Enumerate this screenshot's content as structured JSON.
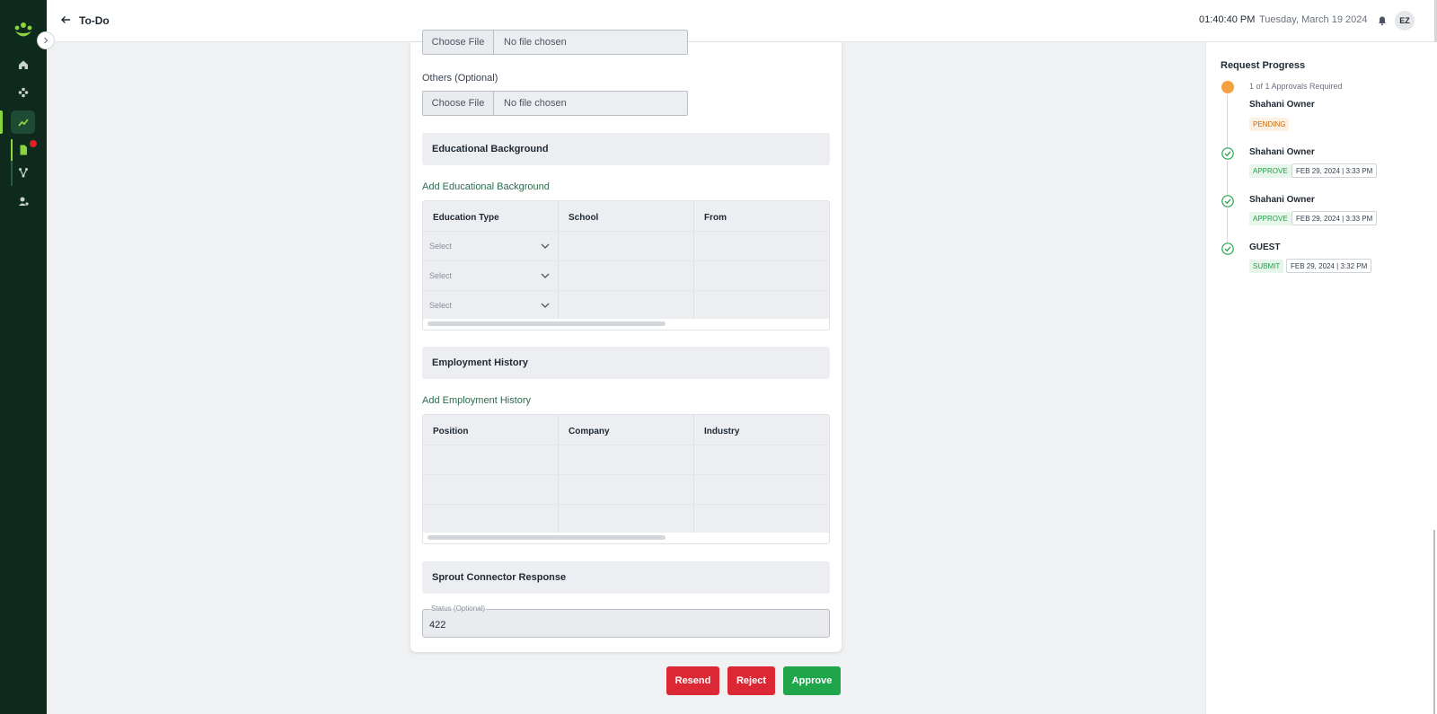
{
  "header": {
    "title": "To-Do",
    "time": "01:40:40 PM",
    "date": "Tuesday, March 19 2024",
    "avatar_initials": "EZ"
  },
  "form": {
    "prev_file": {
      "button": "Choose File",
      "status": "No file chosen"
    },
    "others": {
      "label": "Others (Optional)",
      "button": "Choose File",
      "status": "No file chosen"
    },
    "education": {
      "section_title": "Educational Background",
      "add_label": "Add Educational Background",
      "columns": [
        "Education Type",
        "School",
        "From"
      ],
      "select_placeholder": "Select",
      "row_count": 3
    },
    "employment": {
      "section_title": "Employment History",
      "add_label": "Add Employment History",
      "columns": [
        "Position",
        "Company",
        "Industry"
      ],
      "row_count": 3
    },
    "sprout": {
      "section_title": "Sprout Connector Response",
      "status_label": "Status (Optional)",
      "status_value": "422"
    }
  },
  "actions": {
    "resend": "Resend",
    "reject": "Reject",
    "approve": "Approve"
  },
  "progress": {
    "title": "Request Progress",
    "required_note": "1 of 1 Approvals Required",
    "steps": [
      {
        "name": "Shahani Owner",
        "status": "PENDING",
        "timestamp": ""
      },
      {
        "name": "Shahani Owner",
        "status": "APPROVE",
        "timestamp": "FEB 29, 2024 | 3:33 PM"
      },
      {
        "name": "Shahani Owner",
        "status": "APPROVE",
        "timestamp": "FEB 29, 2024 | 3:33 PM"
      },
      {
        "name": "GUEST",
        "status": "SUBMIT",
        "timestamp": "FEB 29, 2024 | 3:32 PM"
      }
    ]
  },
  "colors": {
    "sidebar_bg": "#0d2a1d",
    "accent_green": "#8bd33f",
    "danger": "#dc2834",
    "success": "#1fa64a",
    "pending": "#f5a142"
  }
}
